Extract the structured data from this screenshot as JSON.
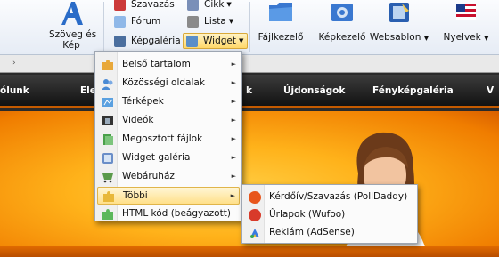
{
  "ribbon": {
    "text_image": "Szöveg és\nKép",
    "poll": "Szavazás",
    "forum": "Fórum",
    "gallery": "Képgaléria",
    "article": "Cikk",
    "list": "Lista",
    "widget": "Widget",
    "file_manager": "Fájlkezelő",
    "image_manager": "Képkezelő",
    "websablon": "Websablon",
    "languages": "Nyelvek"
  },
  "nav": {
    "items": [
      "ólunk",
      "Ele",
      "k",
      "Újdonságok",
      "Fényképgaléria",
      "V"
    ]
  },
  "menu": {
    "items": [
      {
        "label": "Belső tartalom",
        "icon": "puzzle-icon",
        "color": "#e8a83a"
      },
      {
        "label": "Közösségi oldalak",
        "icon": "people-icon",
        "color": "#4a8ad4"
      },
      {
        "label": "Térképek",
        "icon": "map-icon",
        "color": "#5aa0e0"
      },
      {
        "label": "Videók",
        "icon": "film-icon",
        "color": "#333333"
      },
      {
        "label": "Megosztott fájlok",
        "icon": "shared-files-icon",
        "color": "#4aa04a"
      },
      {
        "label": "Widget galéria",
        "icon": "widget-gallery-icon",
        "color": "#6a8ec8"
      },
      {
        "label": "Webáruház",
        "icon": "shop-icon",
        "color": "#5a9a4a"
      },
      {
        "label": "Többi",
        "icon": "puzzle-icon",
        "color": "#e8b83a"
      },
      {
        "label": "HTML kód (beágyazott)",
        "icon": "puzzle-icon",
        "color": "#5cb85c"
      }
    ]
  },
  "submenu": {
    "items": [
      {
        "label": "Kérdőív/Szavazás (PollDaddy)",
        "icon": "polldaddy-icon",
        "color": "#e8561c"
      },
      {
        "label": "Űrlapok (Wufoo)",
        "icon": "wufoo-icon",
        "color": "#d83a2a"
      },
      {
        "label": "Reklám (AdSense)",
        "icon": "adsense-icon",
        "color": "#3a7be0"
      }
    ]
  }
}
